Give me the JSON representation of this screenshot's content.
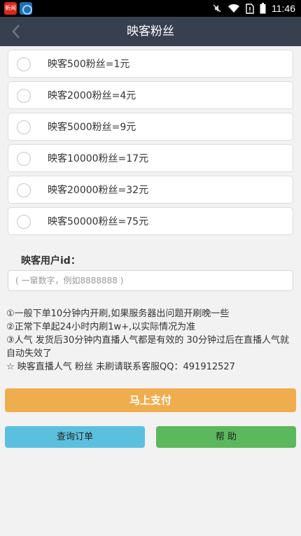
{
  "status_bar": {
    "time": "11:46",
    "left_icons": [
      "news-app-icon",
      "browser-app-icon"
    ],
    "news_icon_text": "新闻",
    "right_icons": [
      "mute-icon",
      "wifi-icon",
      "no-sim-icon",
      "battery-icon"
    ]
  },
  "nav": {
    "back_icon": "chevron-left-icon",
    "title": "映客粉丝"
  },
  "options": [
    {
      "label": "映客500粉丝=1元"
    },
    {
      "label": "映客2000粉丝=4元"
    },
    {
      "label": "映客5000粉丝=9元"
    },
    {
      "label": "映客10000粉丝=17元"
    },
    {
      "label": "映客20000粉丝=32元"
    },
    {
      "label": "映客50000粉丝=75元"
    }
  ],
  "user_id": {
    "label": "映客用户id：",
    "placeholder": "( 一窜数字，例如8888888 )",
    "value": ""
  },
  "notes": [
    "①一般下单10分钟内开刷,如果服务器出问题开刷晚一些",
    "②正常下单起24小时内刷1w+,以实际情况为准",
    "③人气 发货后30分钟内直播人气都是有效的 30分钟过后在直播人气就自动失效了",
    "☆ 映客直播人气 粉丝 未刷请联系客服QQ：491912527"
  ],
  "buttons": {
    "pay": "马上支付",
    "query": "查询订单",
    "help": "帮 助"
  },
  "colors": {
    "navbar": "#384050",
    "pay": "#f0ad4e",
    "query": "#5bc0de",
    "help": "#5cb85c",
    "background": "#f2f2f2"
  }
}
